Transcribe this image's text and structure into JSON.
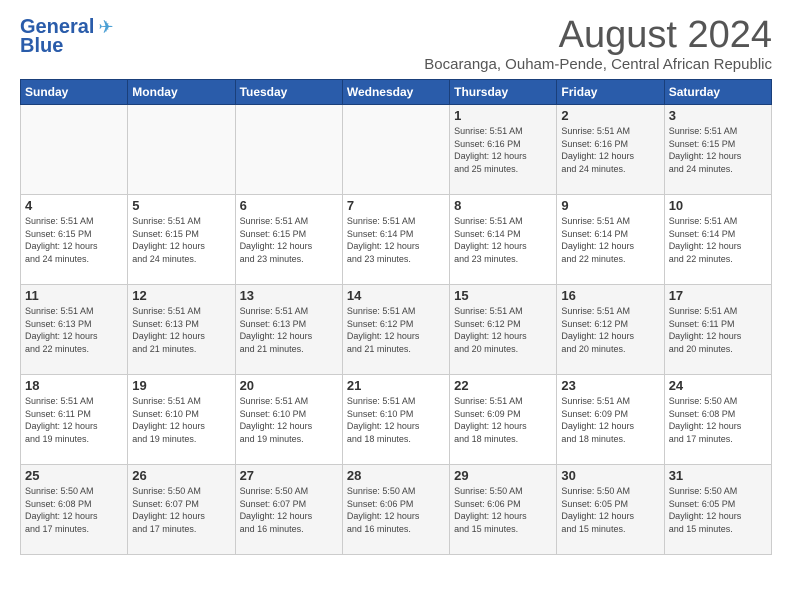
{
  "header": {
    "logo_line1": "General",
    "logo_line2": "Blue",
    "month_title": "August 2024",
    "subtitle": "Bocaranga, Ouham-Pende, Central African Republic"
  },
  "days_of_week": [
    "Sunday",
    "Monday",
    "Tuesday",
    "Wednesday",
    "Thursday",
    "Friday",
    "Saturday"
  ],
  "weeks": [
    [
      {
        "day": "",
        "info": ""
      },
      {
        "day": "",
        "info": ""
      },
      {
        "day": "",
        "info": ""
      },
      {
        "day": "",
        "info": ""
      },
      {
        "day": "1",
        "info": "Sunrise: 5:51 AM\nSunset: 6:16 PM\nDaylight: 12 hours\nand 25 minutes."
      },
      {
        "day": "2",
        "info": "Sunrise: 5:51 AM\nSunset: 6:16 PM\nDaylight: 12 hours\nand 24 minutes."
      },
      {
        "day": "3",
        "info": "Sunrise: 5:51 AM\nSunset: 6:15 PM\nDaylight: 12 hours\nand 24 minutes."
      }
    ],
    [
      {
        "day": "4",
        "info": "Sunrise: 5:51 AM\nSunset: 6:15 PM\nDaylight: 12 hours\nand 24 minutes."
      },
      {
        "day": "5",
        "info": "Sunrise: 5:51 AM\nSunset: 6:15 PM\nDaylight: 12 hours\nand 24 minutes."
      },
      {
        "day": "6",
        "info": "Sunrise: 5:51 AM\nSunset: 6:15 PM\nDaylight: 12 hours\nand 23 minutes."
      },
      {
        "day": "7",
        "info": "Sunrise: 5:51 AM\nSunset: 6:14 PM\nDaylight: 12 hours\nand 23 minutes."
      },
      {
        "day": "8",
        "info": "Sunrise: 5:51 AM\nSunset: 6:14 PM\nDaylight: 12 hours\nand 23 minutes."
      },
      {
        "day": "9",
        "info": "Sunrise: 5:51 AM\nSunset: 6:14 PM\nDaylight: 12 hours\nand 22 minutes."
      },
      {
        "day": "10",
        "info": "Sunrise: 5:51 AM\nSunset: 6:14 PM\nDaylight: 12 hours\nand 22 minutes."
      }
    ],
    [
      {
        "day": "11",
        "info": "Sunrise: 5:51 AM\nSunset: 6:13 PM\nDaylight: 12 hours\nand 22 minutes."
      },
      {
        "day": "12",
        "info": "Sunrise: 5:51 AM\nSunset: 6:13 PM\nDaylight: 12 hours\nand 21 minutes."
      },
      {
        "day": "13",
        "info": "Sunrise: 5:51 AM\nSunset: 6:13 PM\nDaylight: 12 hours\nand 21 minutes."
      },
      {
        "day": "14",
        "info": "Sunrise: 5:51 AM\nSunset: 6:12 PM\nDaylight: 12 hours\nand 21 minutes."
      },
      {
        "day": "15",
        "info": "Sunrise: 5:51 AM\nSunset: 6:12 PM\nDaylight: 12 hours\nand 20 minutes."
      },
      {
        "day": "16",
        "info": "Sunrise: 5:51 AM\nSunset: 6:12 PM\nDaylight: 12 hours\nand 20 minutes."
      },
      {
        "day": "17",
        "info": "Sunrise: 5:51 AM\nSunset: 6:11 PM\nDaylight: 12 hours\nand 20 minutes."
      }
    ],
    [
      {
        "day": "18",
        "info": "Sunrise: 5:51 AM\nSunset: 6:11 PM\nDaylight: 12 hours\nand 19 minutes."
      },
      {
        "day": "19",
        "info": "Sunrise: 5:51 AM\nSunset: 6:10 PM\nDaylight: 12 hours\nand 19 minutes."
      },
      {
        "day": "20",
        "info": "Sunrise: 5:51 AM\nSunset: 6:10 PM\nDaylight: 12 hours\nand 19 minutes."
      },
      {
        "day": "21",
        "info": "Sunrise: 5:51 AM\nSunset: 6:10 PM\nDaylight: 12 hours\nand 18 minutes."
      },
      {
        "day": "22",
        "info": "Sunrise: 5:51 AM\nSunset: 6:09 PM\nDaylight: 12 hours\nand 18 minutes."
      },
      {
        "day": "23",
        "info": "Sunrise: 5:51 AM\nSunset: 6:09 PM\nDaylight: 12 hours\nand 18 minutes."
      },
      {
        "day": "24",
        "info": "Sunrise: 5:50 AM\nSunset: 6:08 PM\nDaylight: 12 hours\nand 17 minutes."
      }
    ],
    [
      {
        "day": "25",
        "info": "Sunrise: 5:50 AM\nSunset: 6:08 PM\nDaylight: 12 hours\nand 17 minutes."
      },
      {
        "day": "26",
        "info": "Sunrise: 5:50 AM\nSunset: 6:07 PM\nDaylight: 12 hours\nand 17 minutes."
      },
      {
        "day": "27",
        "info": "Sunrise: 5:50 AM\nSunset: 6:07 PM\nDaylight: 12 hours\nand 16 minutes."
      },
      {
        "day": "28",
        "info": "Sunrise: 5:50 AM\nSunset: 6:06 PM\nDaylight: 12 hours\nand 16 minutes."
      },
      {
        "day": "29",
        "info": "Sunrise: 5:50 AM\nSunset: 6:06 PM\nDaylight: 12 hours\nand 15 minutes."
      },
      {
        "day": "30",
        "info": "Sunrise: 5:50 AM\nSunset: 6:05 PM\nDaylight: 12 hours\nand 15 minutes."
      },
      {
        "day": "31",
        "info": "Sunrise: 5:50 AM\nSunset: 6:05 PM\nDaylight: 12 hours\nand 15 minutes."
      }
    ]
  ]
}
